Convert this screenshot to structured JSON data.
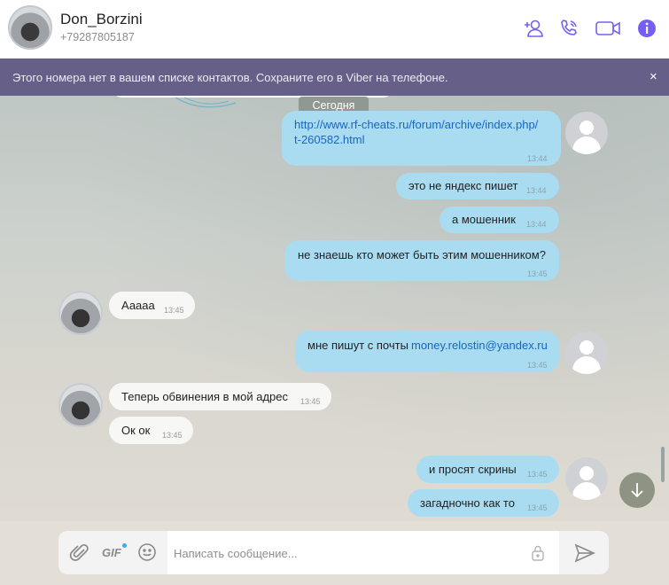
{
  "header": {
    "name": "Don_Borzini",
    "phone": "+79287805187"
  },
  "banner": {
    "text": "Этого номера нет в вашем списке контактов. Сохраните его в Viber на телефоне.",
    "close": "×"
  },
  "chat": {
    "date_chip": "Сегодня",
    "messages": [
      {
        "dir": "out",
        "text": "http://www.rf-cheats.ru/forum/archive/index.php/",
        "text2": "t-260582.html",
        "time": "13:44"
      },
      {
        "dir": "out",
        "text": "это не яндекс пишет",
        "time": "13:44"
      },
      {
        "dir": "out",
        "text": "а мошенник",
        "time": "13:44"
      },
      {
        "dir": "out",
        "text": "не знаешь кто может быть этим мошенником?",
        "time": "13:45"
      },
      {
        "dir": "in",
        "text": "Ааааа",
        "time": "13:45"
      },
      {
        "dir": "out",
        "text": "мне пишут с почты ",
        "link": "money.relostin@yandex.ru",
        "time": "13:45"
      },
      {
        "dir": "in",
        "text": "Теперь обвинения в мой адрес",
        "time": "13:45"
      },
      {
        "dir": "in",
        "text": "Ок ок",
        "time": "13:45"
      },
      {
        "dir": "out",
        "text": "и просят скрины",
        "time": "13:45"
      },
      {
        "dir": "out",
        "text": "загадночно как то",
        "time": "13:45"
      }
    ]
  },
  "composer": {
    "gif_label": "GIF",
    "placeholder": "Написать сообщение..."
  },
  "colors": {
    "banner": "#665f87",
    "accent": "#7360f2",
    "outgoing_bubble": "#a9dcf1",
    "incoming_bubble": "#f7f7f5"
  },
  "icons": [
    "add-contact-icon",
    "call-icon",
    "video-call-icon",
    "info-icon",
    "close-icon",
    "attach-icon",
    "gif-icon",
    "emoji-icon",
    "lock-icon",
    "send-icon",
    "arrow-down-icon"
  ]
}
